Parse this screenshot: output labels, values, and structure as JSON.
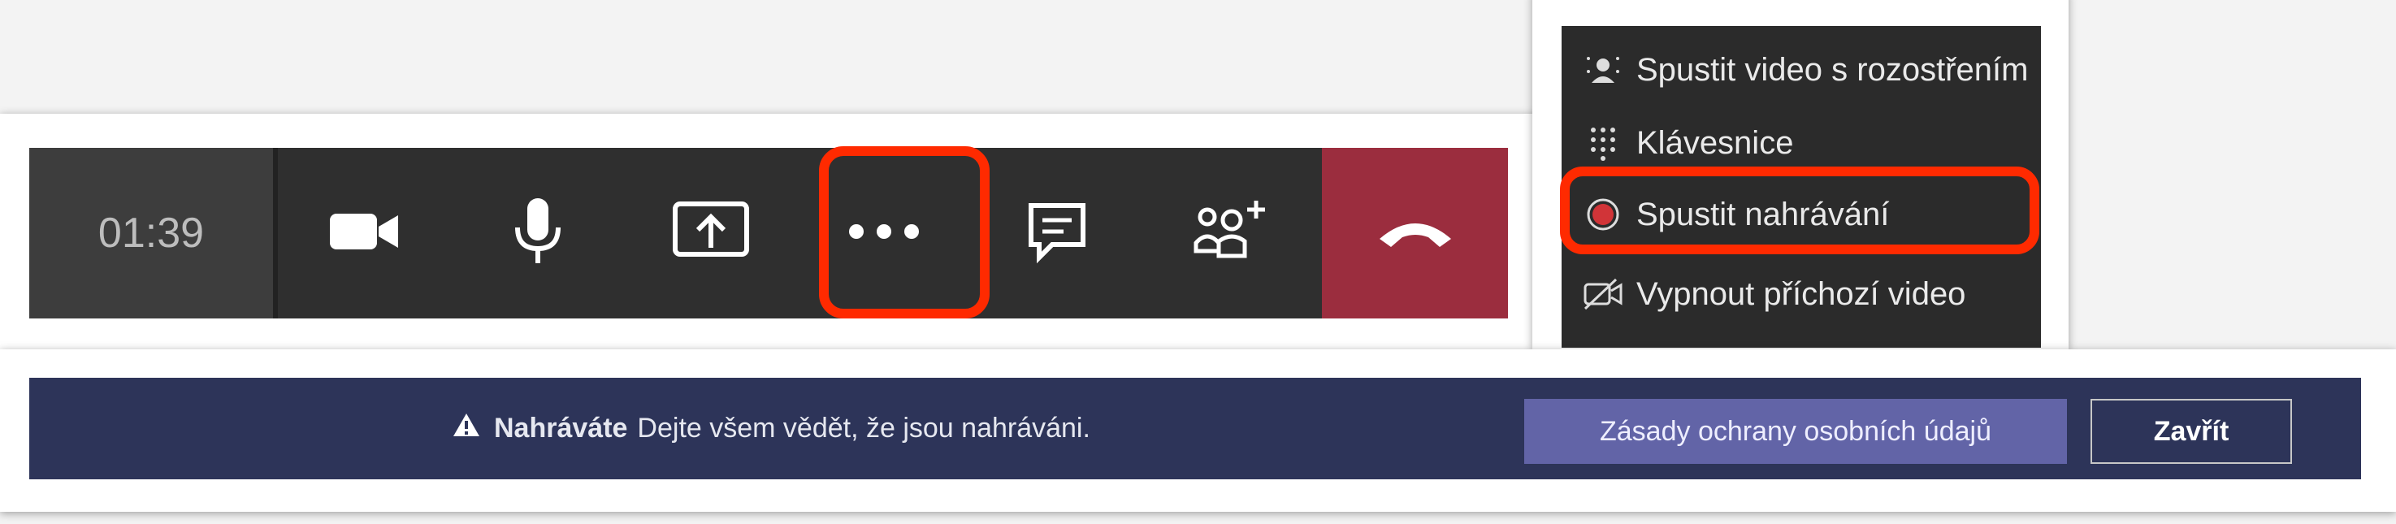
{
  "call_bar": {
    "timer": "01:39",
    "buttons": [
      {
        "icon": "camera-icon"
      },
      {
        "icon": "microphone-icon"
      },
      {
        "icon": "share-screen-icon"
      },
      {
        "icon": "more-options-icon"
      },
      {
        "icon": "chat-icon"
      },
      {
        "icon": "participants-icon"
      },
      {
        "icon": "hang-up-icon"
      }
    ],
    "hangup_color": "#9b2d3e",
    "highlight_color": "#ff2a00"
  },
  "menu": {
    "items": [
      {
        "label": "Spustit video s rozostřením",
        "icon": "blur-background-icon"
      },
      {
        "label": "Klávesnice",
        "icon": "keypad-icon"
      },
      {
        "label": "Spustit nahrávání",
        "icon": "record-icon"
      },
      {
        "label": "Vypnout příchozí video",
        "icon": "video-off-icon"
      }
    ],
    "record_color": "#d13438"
  },
  "banner": {
    "title": "Nahráváte",
    "message": "Dejte všem vědět, že jsou nahráváni.",
    "primary_button": "Zásady ochrany osobních údajů",
    "close_button": "Zavřít",
    "background": "#2d3459",
    "primary_color": "#6264a7"
  }
}
